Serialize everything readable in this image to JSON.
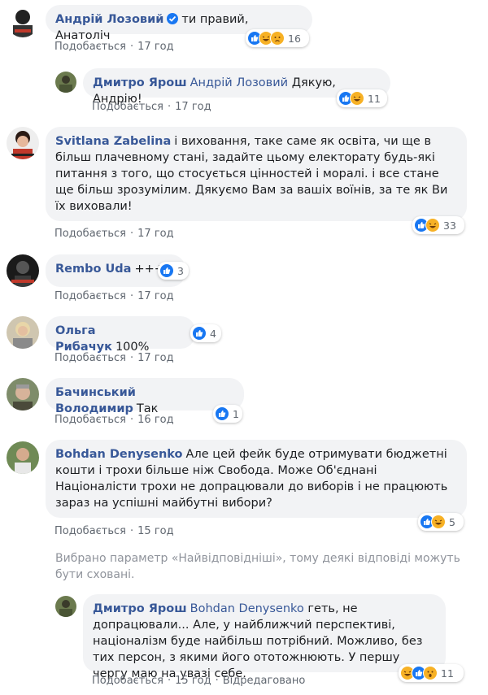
{
  "comments": [
    {
      "author": "Андрій Лозовий",
      "text": "ти правий, Анатоліч",
      "like": "Подобається",
      "time": "17 год",
      "reactions": [
        "like",
        "haha",
        "sad"
      ],
      "count": "16"
    },
    {
      "author": "Дмитро Ярош",
      "mention": "Андрій Лозовий",
      "text": "Дякую, Андрію!",
      "like": "Подобається",
      "time": "17 год",
      "reactions": [
        "like",
        "haha"
      ],
      "count": "11"
    },
    {
      "author": "Svitlana Zabelina",
      "text": "і виховання, таке саме як освіта, чи ще в більш плачевному стані, задайте цьому електорату будь-які питання з того, що стосується цінностей і моралі. і все стане ще більш зрозумілим. Дякуємо Вам за вашіх воїнів, за те як Ви їх виховали!",
      "like": "Подобається",
      "time": "17 год",
      "reactions": [
        "like",
        "haha"
      ],
      "count": "33"
    },
    {
      "author": "Rembo Uda",
      "text": "+++",
      "like": "Подобається",
      "time": "17 год",
      "reactions": [
        "like"
      ],
      "count": "3"
    },
    {
      "author": "Ольга Рибачук",
      "text": "100%",
      "like": "Подобається",
      "time": "17 год",
      "reactions": [
        "like"
      ],
      "count": "4"
    },
    {
      "author": "Бачинський Володимир",
      "text": "Так",
      "like": "Подобається",
      "time": "16 год",
      "reactions": [
        "like"
      ],
      "count": "1"
    },
    {
      "author": "Bohdan Denysenko",
      "text": "Але цей фейк буде отримувати бюджетні кошти і трохи більше ніж Свобода. Може Об'єднані Націоналісти трохи не допрацювали до виборів і не працюють зараз на успішні майбутні вибори?",
      "like": "Подобається",
      "time": "15 год",
      "reactions": [
        "like",
        "haha"
      ],
      "count": "5"
    },
    {
      "author": "Дмитро Ярош",
      "mention": "Bohdan Denysenko",
      "text": "геть, не допрацювали... Але, у найближчий перспективі, націоналізм буде найбільш потрібний. Можливо, без тих персон, з якими його ототожнюють. У першу чергу маю на увазі себе.",
      "like": "Подобається",
      "time": "15 год",
      "edited": "Відредаговано",
      "reactions": [
        "haha",
        "like",
        "wow"
      ],
      "count": "11"
    }
  ],
  "filter_note": "Вибрано параметр «Найвідповідніші», тому деякі відповіді можуть бути сховані."
}
